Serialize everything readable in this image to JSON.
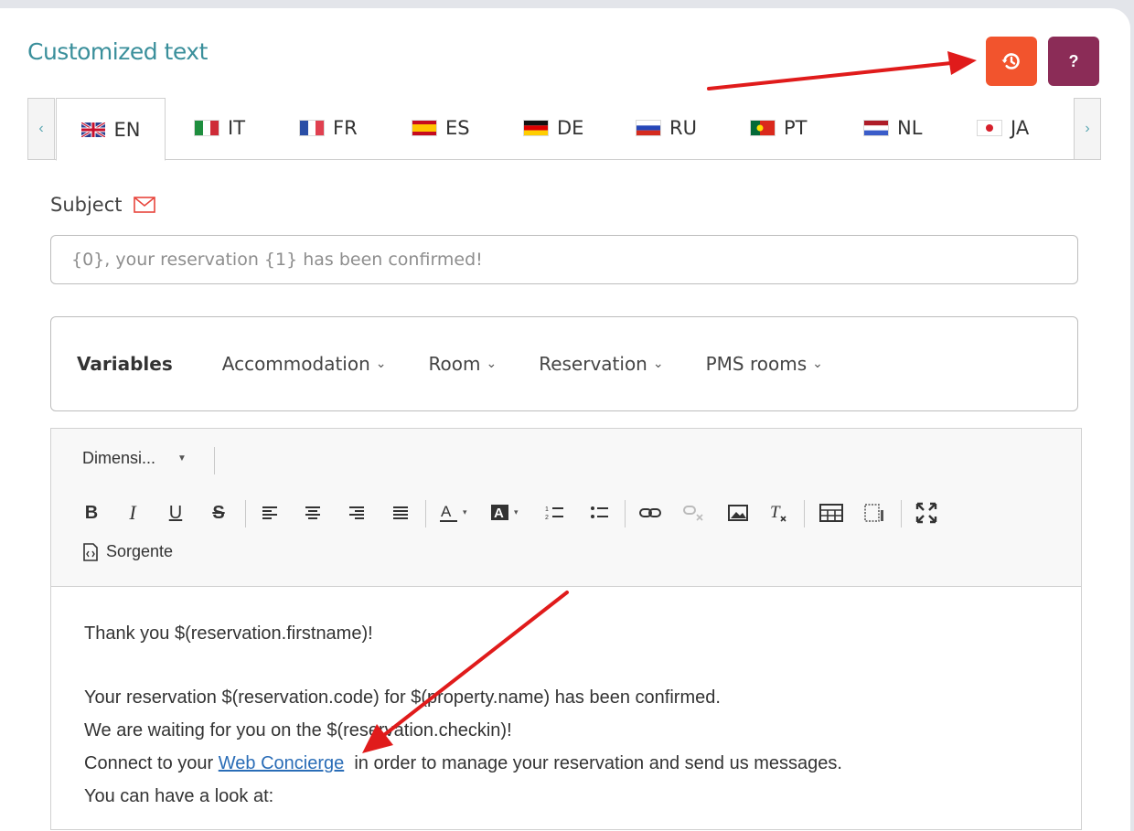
{
  "panel": {
    "title": "Customized text",
    "history_button": "history-icon",
    "help_label": "?"
  },
  "tabs": {
    "left_arrow": "‹",
    "right_arrow": "›",
    "items": [
      {
        "code": "EN",
        "flag": "uk",
        "active": true
      },
      {
        "code": "IT",
        "flag": "it",
        "active": false
      },
      {
        "code": "FR",
        "flag": "fr",
        "active": false
      },
      {
        "code": "ES",
        "flag": "es",
        "active": false
      },
      {
        "code": "DE",
        "flag": "de",
        "active": false
      },
      {
        "code": "RU",
        "flag": "ru",
        "active": false
      },
      {
        "code": "PT",
        "flag": "pt",
        "active": false
      },
      {
        "code": "NL",
        "flag": "nl",
        "active": false
      },
      {
        "code": "JA",
        "flag": "jp",
        "active": false
      }
    ]
  },
  "subject": {
    "label": "Subject",
    "placeholder": "{0}, your reservation {1} has been confirmed!"
  },
  "variables": {
    "label": "Variables",
    "menus": [
      "Accommodation",
      "Room",
      "Reservation",
      "PMS rooms"
    ]
  },
  "editor": {
    "size_combo": "Dimensi...",
    "source_label": "Sorgente",
    "content": {
      "line1": "Thank you $(reservation.firstname)!",
      "line2": "Your reservation $(reservation.code) for $(property.name) has been confirmed.",
      "line3": "We are waiting for you on the $(reservation.checkin)!",
      "line4_before": "Connect to your ",
      "line4_link": "Web Concierge",
      "line4_after": "  in order to manage your reservation and send us messages.",
      "line5": "You can have a look at:"
    }
  },
  "colors": {
    "title": "#3a8f9b",
    "history_button": "#f2542d",
    "help_button": "#8b2c57",
    "annotation_arrow": "#e01b1b",
    "link": "#2a6db7"
  }
}
